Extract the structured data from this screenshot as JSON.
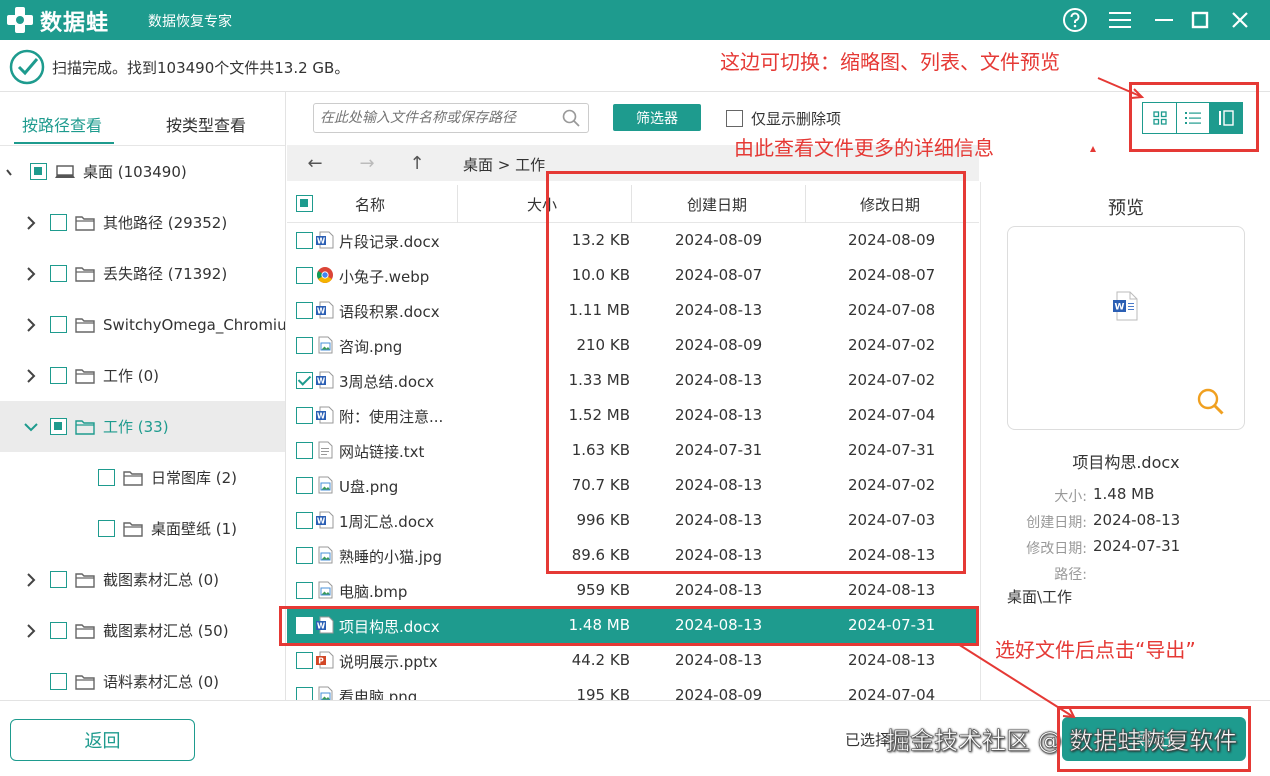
{
  "app": {
    "name": "数据蛙",
    "subtitle": "数据恢复专家"
  },
  "scan": {
    "status": "扫描完成。找到103490个文件共13.2 GB。"
  },
  "left_tabs": [
    {
      "label": "按路径查看",
      "active": true
    },
    {
      "label": "按类型查看",
      "active": false
    }
  ],
  "tree": [
    {
      "label": "桌面 (103490)",
      "check": "partial",
      "icon": "computer-icon"
    },
    {
      "label": "其他路径 (29352)",
      "check": "none",
      "icon": "folder-icon"
    },
    {
      "label": "丢失路径 (71392)",
      "check": "none",
      "icon": "folder-icon"
    },
    {
      "label": "SwitchyOmega_Chromium",
      "check": "none",
      "icon": "folder-icon"
    },
    {
      "label": "工作 (0)",
      "check": "none",
      "icon": "folder-icon"
    },
    {
      "label": "工作 (33)",
      "check": "partial",
      "icon": "folder-icon"
    },
    {
      "label": "日常图库 (2)",
      "check": "none",
      "icon": "folder-icon"
    },
    {
      "label": "桌面壁纸 (1)",
      "check": "none",
      "icon": "folder-icon"
    },
    {
      "label": "截图素材汇总 (0)",
      "check": "none",
      "icon": "folder-icon"
    },
    {
      "label": "截图素材汇总 (50)",
      "check": "none",
      "icon": "folder-icon"
    },
    {
      "label": "语料素材汇总 (0)",
      "check": "none",
      "icon": "folder-icon"
    }
  ],
  "toolbar": {
    "search_placeholder": "在此处输入文件名称或保存路径",
    "filter_label": "筛选器",
    "only_deleted_label": "仅显示删除项"
  },
  "path": {
    "breadcrumb": "桌面 > 工作"
  },
  "table": {
    "headers": {
      "name": "名称",
      "size": "大小",
      "created": "创建日期",
      "modified": "修改日期"
    },
    "rows": [
      {
        "name": "片段记录.docx",
        "size": "13.2 KB",
        "created": "2024-08-09",
        "modified": "2024-08-09",
        "type": "word",
        "checked": false,
        "selected": false
      },
      {
        "name": "小兔子.webp",
        "size": "10.0 KB",
        "created": "2024-08-07",
        "modified": "2024-08-07",
        "type": "chrome",
        "checked": false,
        "selected": false
      },
      {
        "name": "语段积累.docx",
        "size": "1.11 MB",
        "created": "2024-08-13",
        "modified": "2024-07-08",
        "type": "word",
        "checked": false,
        "selected": false
      },
      {
        "name": "咨询.png",
        "size": "210 KB",
        "created": "2024-08-09",
        "modified": "2024-07-02",
        "type": "image",
        "checked": false,
        "selected": false
      },
      {
        "name": "3周总结.docx",
        "size": "1.33 MB",
        "created": "2024-08-13",
        "modified": "2024-07-02",
        "type": "word",
        "checked": true,
        "selected": false
      },
      {
        "name": "附：使用注意...",
        "size": "1.52 MB",
        "created": "2024-08-13",
        "modified": "2024-07-04",
        "type": "word",
        "checked": false,
        "selected": false
      },
      {
        "name": "网站链接.txt",
        "size": "1.63 KB",
        "created": "2024-07-31",
        "modified": "2024-07-31",
        "type": "text",
        "checked": false,
        "selected": false
      },
      {
        "name": "U盘.png",
        "size": "70.7 KB",
        "created": "2024-08-13",
        "modified": "2024-07-02",
        "type": "image",
        "checked": false,
        "selected": false
      },
      {
        "name": "1周汇总.docx",
        "size": "996 KB",
        "created": "2024-08-13",
        "modified": "2024-07-03",
        "type": "word",
        "checked": false,
        "selected": false
      },
      {
        "name": "熟睡的小猫.jpg",
        "size": "89.6 KB",
        "created": "2024-08-13",
        "modified": "2024-08-13",
        "type": "image",
        "checked": false,
        "selected": false
      },
      {
        "name": "电脑.bmp",
        "size": "959 KB",
        "created": "2024-08-13",
        "modified": "2024-08-13",
        "type": "image",
        "checked": false,
        "selected": false
      },
      {
        "name": "项目构思.docx",
        "size": "1.48 MB",
        "created": "2024-08-13",
        "modified": "2024-07-31",
        "type": "word",
        "checked": false,
        "selected": true
      },
      {
        "name": "说明展示.pptx",
        "size": "44.2 KB",
        "created": "2024-08-13",
        "modified": "2024-08-13",
        "type": "ppt",
        "checked": false,
        "selected": false
      },
      {
        "name": "看电脑.png",
        "size": "195 KB",
        "created": "2024-08-09",
        "modified": "2024-07-04",
        "type": "image",
        "checked": false,
        "selected": false
      }
    ]
  },
  "preview": {
    "title": "预览",
    "filename": "项目构思.docx",
    "fields": [
      {
        "label": "大小:",
        "value": "1.48 MB"
      },
      {
        "label": "创建日期:",
        "value": "2024-08-13"
      },
      {
        "label": "修改日期:",
        "value": "2024-07-31"
      },
      {
        "label": "路径:",
        "value": ""
      }
    ],
    "path_value": "桌面\\工作"
  },
  "bottom": {
    "back_label": "返回",
    "selected_info": "已选择",
    "export_label": "导出",
    "watermark": "掘金技术社区 @ 数据蛙恢复软件"
  },
  "annotations": {
    "switch_hint": "这边可切换：缩略图、列表、文件预览",
    "detail_hint": "由此查看文件更多的详细信息",
    "export_hint": "选好文件后点击“导出”"
  },
  "colors": {
    "accent": "#1e9b8e",
    "annotation": "#e53935",
    "selected_tree_bg": "#ebebeb"
  }
}
